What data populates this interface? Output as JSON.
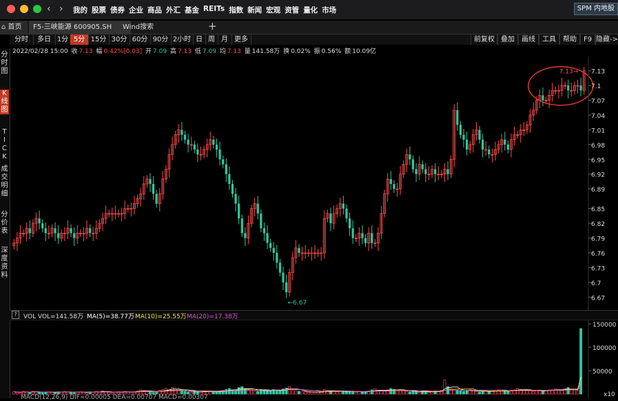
{
  "window": {
    "menu": [
      "我的",
      "股票",
      "债券",
      "企业",
      "商品",
      "外汇",
      "基金",
      "REITs",
      "指数",
      "新闻",
      "宏观",
      "资管",
      "量化",
      "市场"
    ],
    "right_button": "SPM 内地股"
  },
  "tabs": {
    "home": "首页",
    "items": [
      "F5-三峡能源 600905.SH",
      "Wind搜索"
    ],
    "add": "+"
  },
  "periods": {
    "items": [
      "分时",
      "多日",
      "1分",
      "5分",
      "15分",
      "30分",
      "60分",
      "90分",
      "2小时",
      "日",
      "周",
      "月",
      "更多"
    ],
    "active": "5分",
    "tools": [
      "前复权",
      "叠加",
      "画线",
      "工具",
      "帮助",
      "F9",
      "隐藏->"
    ]
  },
  "side_nav": [
    "分时图",
    "K线图",
    "TICK",
    "成交明细",
    "分价表",
    "深度资料"
  ],
  "side_nav_active": "K线图",
  "quote": {
    "datetime": "2022/02/28 15:00",
    "close_label": "收",
    "close": "7.13",
    "change_label": "幅",
    "change": "0.42%[0.03]",
    "open_label": "开",
    "open": "7.09",
    "high_label": "高",
    "high": "7.13",
    "low_label": "低",
    "low": "7.09",
    "avg_label": "均",
    "avg": "7.13",
    "volume_label": "量",
    "volume": "141.58万",
    "turnover_label": "换",
    "turnover": "0.02%",
    "amplitude_label": "振",
    "amplitude": "0.56%",
    "amount_label": "额",
    "amount": "10.09亿"
  },
  "volume_header": {
    "help": "?",
    "vol": "VOL  VOL=141.58万",
    "ma5": "MA(5)=38.77万",
    "ma10": "MA(10)=25.55万",
    "ma20": "MA(20)=17.38万"
  },
  "macd_row": "MACD(12,26,9)  DIF=0.00005  DEA=0.00707  MACD=0.00307",
  "colors": {
    "up": "#ff4a4a",
    "down": "#2ec7a0",
    "accent": "#c23b22",
    "ma5": "#ffffff",
    "ma10": "#f0e040",
    "ma20": "#e050e0"
  },
  "chart_data": {
    "type": "candlestick",
    "title": "",
    "xlabel": "",
    "ylabel": "",
    "ylim": [
      6.655,
      7.145
    ],
    "y_ticks": [
      "7.13",
      "7.1",
      "7.07",
      "7.04",
      "7.01",
      "6.98",
      "6.95",
      "6.92",
      "6.89",
      "6.85",
      "6.82",
      "6.79",
      "6.76",
      "6.73",
      "6.7",
      "6.67"
    ],
    "annotations": [
      {
        "text": "7.13",
        "at": "high"
      },
      {
        "text": "6.67",
        "at": "low"
      }
    ],
    "close_series": [
      6.78,
      6.79,
      6.8,
      6.8,
      6.81,
      6.8,
      6.82,
      6.83,
      6.82,
      6.81,
      6.8,
      6.8,
      6.81,
      6.8,
      6.79,
      6.8,
      6.8,
      6.81,
      6.8,
      6.79,
      6.8,
      6.8,
      6.8,
      6.81,
      6.8,
      6.8,
      6.81,
      6.82,
      6.83,
      6.84,
      6.84,
      6.84,
      6.84,
      6.84,
      6.84,
      6.85,
      6.85,
      6.85,
      6.86,
      6.87,
      6.88,
      6.9,
      6.91,
      6.9,
      6.88,
      6.86,
      6.88,
      6.91,
      6.93,
      6.96,
      6.98,
      7.0,
      7.01,
      7.0,
      6.99,
      6.98,
      6.98,
      6.97,
      6.96,
      6.96,
      6.97,
      6.98,
      6.99,
      6.98,
      6.97,
      6.95,
      6.94,
      6.92,
      6.9,
      6.88,
      6.86,
      6.83,
      6.8,
      6.79,
      6.82,
      6.85,
      6.86,
      6.84,
      6.81,
      6.8,
      6.78,
      6.77,
      6.76,
      6.74,
      6.72,
      6.7,
      6.68,
      6.72,
      6.75,
      6.77,
      6.76,
      6.76,
      6.76,
      6.76,
      6.76,
      6.76,
      6.76,
      6.76,
      6.83,
      6.84,
      6.82,
      6.84,
      6.85,
      6.86,
      6.85,
      6.83,
      6.81,
      6.79,
      6.79,
      6.8,
      6.79,
      6.78,
      6.8,
      6.78,
      6.78,
      6.8,
      6.84,
      6.88,
      6.91,
      6.9,
      6.89,
      6.89,
      6.92,
      6.94,
      6.96,
      6.95,
      6.93,
      6.92,
      6.94,
      6.93,
      6.92,
      6.92,
      6.93,
      6.92,
      6.92,
      6.92,
      6.93,
      6.92,
      6.95,
      7.05,
      7.02,
      7.0,
      6.99,
      6.97,
      6.98,
      7.0,
      7.01,
      6.99,
      6.97,
      6.97,
      6.96,
      6.96,
      6.97,
      6.98,
      6.99,
      6.98,
      6.97,
      6.99,
      7.0,
      7.0,
      7.01,
      7.01,
      7.02,
      7.04,
      7.05,
      7.07,
      7.08,
      7.07,
      7.07,
      7.08,
      7.09,
      7.09,
      7.09,
      7.1,
      7.1,
      7.09,
      7.09,
      7.1,
      7.1,
      7.09,
      7.13
    ],
    "volume": {
      "ylim": [
        0,
        150000
      ],
      "y_ticks": [
        "150000",
        "100000",
        "50000"
      ],
      "unit": "x10",
      "values": [
        5,
        4,
        3,
        6,
        5,
        4,
        6,
        5,
        4,
        3,
        4,
        5,
        4,
        3,
        5,
        4,
        6,
        5,
        4,
        3,
        4,
        5,
        4,
        3,
        5,
        4,
        6,
        5,
        7,
        5,
        4,
        3,
        4,
        5,
        4,
        6,
        5,
        4,
        5,
        7,
        9,
        8,
        6,
        5,
        4,
        6,
        8,
        10,
        12,
        9,
        14,
        11,
        8,
        7,
        6,
        5,
        4,
        6,
        5,
        4,
        5,
        6,
        7,
        5,
        4,
        6,
        8,
        10,
        12,
        9,
        8,
        14,
        16,
        12,
        9,
        8,
        7,
        6,
        9,
        8,
        7,
        6,
        10,
        9,
        8,
        11,
        13,
        16,
        9,
        7,
        6,
        5,
        5,
        4,
        4,
        4,
        4,
        5,
        9,
        8,
        7,
        6,
        5,
        6,
        5,
        7,
        6,
        5,
        4,
        5,
        4,
        6,
        7,
        9,
        11,
        8,
        7,
        6,
        9,
        12,
        10,
        9,
        8,
        7,
        6,
        5,
        6,
        5,
        4,
        6,
        5,
        4,
        5,
        6,
        7,
        8,
        30,
        16,
        12,
        10,
        8,
        7,
        6,
        8,
        9,
        7,
        6,
        5,
        6,
        7,
        5,
        6,
        7,
        8,
        9,
        7,
        6,
        8,
        9,
        12,
        10,
        8,
        9,
        7,
        6,
        8,
        7,
        6,
        8,
        9,
        10,
        11,
        9,
        8,
        12,
        14,
        10,
        9,
        8,
        140
      ]
    }
  }
}
